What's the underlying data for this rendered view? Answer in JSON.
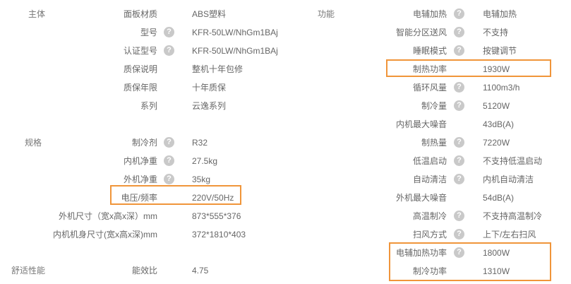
{
  "left": {
    "sections": [
      {
        "key": "main",
        "title": "主体"
      },
      {
        "key": "spec",
        "title": "规格"
      },
      {
        "key": "comfort",
        "title": "舒适性能"
      }
    ],
    "rows": [
      {
        "label": "面板材质",
        "value": "ABS塑料",
        "help": false
      },
      {
        "label": "型号",
        "value": "KFR-50LW/NhGm1BAj",
        "help": true
      },
      {
        "label": "认证型号",
        "value": "KFR-50LW/NhGm1BAj",
        "help": true
      },
      {
        "label": "质保说明",
        "value": "整机十年包修",
        "help": false
      },
      {
        "label": "质保年限",
        "value": "十年质保",
        "help": false
      },
      {
        "label": "系列",
        "value": "云逸系列",
        "help": false
      },
      {
        "label": "制冷剂",
        "value": "R32",
        "help": true
      },
      {
        "label": "内机净重",
        "value": "27.5kg",
        "help": true
      },
      {
        "label": "外机净重",
        "value": "35kg",
        "help": true
      },
      {
        "label": "电压/频率",
        "value": "220V/50Hz",
        "help": false
      },
      {
        "label": "外机尺寸（宽x高x深）mm",
        "value": "873*555*376",
        "help": false
      },
      {
        "label": "内机机身尺寸(宽x高x深)mm",
        "value": "372*1810*403",
        "help": false
      },
      {
        "label": "能效比",
        "value": "4.75",
        "help": false
      }
    ]
  },
  "right": {
    "section_title": "功能",
    "rows": [
      {
        "label": "电辅加热",
        "value": "电辅加热",
        "help": true
      },
      {
        "label": "智能分区送风",
        "value": "不支持",
        "help": true
      },
      {
        "label": "睡眠模式",
        "value": "按键调节",
        "help": true
      },
      {
        "label": "制热功率",
        "value": "1930W",
        "help": false
      },
      {
        "label": "循环风量",
        "value": "1100m3/h",
        "help": true
      },
      {
        "label": "制冷量",
        "value": "5120W",
        "help": true
      },
      {
        "label": "内机最大噪音",
        "value": "43dB(A)",
        "help": false
      },
      {
        "label": "制热量",
        "value": "7220W",
        "help": true
      },
      {
        "label": "低温启动",
        "value": "不支持低温启动",
        "help": true
      },
      {
        "label": "自动清洁",
        "value": "内机自动清洁",
        "help": true
      },
      {
        "label": "外机最大噪音",
        "value": "54dB(A)",
        "help": false
      },
      {
        "label": "高温制冷",
        "value": "不支持高温制冷",
        "help": true
      },
      {
        "label": "扫风方式",
        "value": "上下/左右扫风",
        "help": true
      },
      {
        "label": "电辅加热功率",
        "value": "1800W",
        "help": true
      },
      {
        "label": "制冷功率",
        "value": "1310W",
        "help": false
      }
    ]
  },
  "colors": {
    "highlight": "#f0953a",
    "help_bg": "#c9c9c9",
    "text": "#666666"
  },
  "icons": {
    "help": "question-circle-icon"
  },
  "help_glyph": "?"
}
